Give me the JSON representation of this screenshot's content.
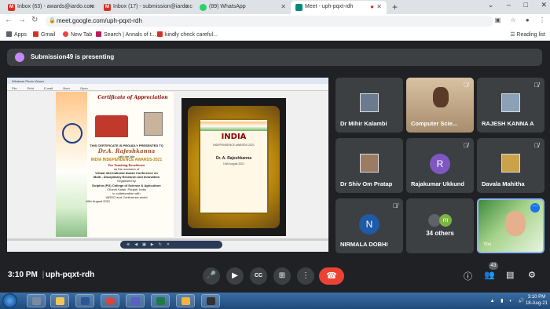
{
  "browser": {
    "tabs": [
      {
        "label": "Inbox (63) - awards@iardo.com",
        "favicon_color": "#d93025",
        "active": false
      },
      {
        "label": "Inbox (17) - submission@iardo.c",
        "favicon_color": "#d93025",
        "active": false
      },
      {
        "label": "(89) WhatsApp",
        "favicon_color": "#25d366",
        "active": false
      },
      {
        "label": "Meet - uph-pqxt-rdh",
        "favicon_color": "#00897b",
        "active": true
      }
    ],
    "url": "meet.google.com/uph-pqxt-rdh",
    "bookmarks": [
      {
        "label": "Apps",
        "color": "#5f6368"
      },
      {
        "label": "Gmail",
        "color": "#d93025"
      },
      {
        "label": "New Tab",
        "color": "#e8453c"
      },
      {
        "label": "Search | Annals of t...",
        "color": "#c2185b"
      },
      {
        "label": "kindly check careful...",
        "color": "#d93025"
      }
    ],
    "reading_list": "Reading list"
  },
  "meet": {
    "presenting_banner": "Submission49 is presenting",
    "shared_screen": {
      "window_title": "Windows Photo Viewer",
      "menu": [
        "File",
        "Print",
        "E-mail",
        "Burn",
        "Open"
      ],
      "certificate": {
        "title": "Certificate of Appreciation",
        "lines": [
          "THIS CERTIFICATE IS PROUDLY PRESENTED TO",
          "Dr.A. Rajeshkanna",
          "with the title",
          "INDIA INDEPENDENCE AWARDS-2021",
          "For Teaching Excellence",
          "on the occasion of",
          "Virtual International Award Conference on",
          "Multi - Disciplinary Research and Innovation",
          "Organised by",
          "Dolphin (PG) College of Science & Agriculture",
          "Chunni Kalan, Punjab, India",
          "in collaboration with",
          "IARDO and Conference world",
          "16th August 2021"
        ]
      },
      "framed": {
        "heading": "INDIA",
        "subheading": "INDEPENDENCE AWARDS-2021",
        "name": "Dr. A. Rajeshkanna",
        "date": "16th August 2021"
      }
    },
    "participants": [
      {
        "name": "Dr Mihir Kalambi",
        "type": "photo",
        "muted": false
      },
      {
        "name": "Computer Scie...",
        "type": "camera",
        "muted": true
      },
      {
        "name": "RAJESH KANNA A",
        "type": "photo",
        "muted": true
      },
      {
        "name": "Dr Shiv Om Pratap",
        "type": "photo",
        "muted": false
      },
      {
        "name": "Rajakumar Ukkund",
        "type": "initial",
        "initial": "R",
        "color": "#7e57c2",
        "muted": true
      },
      {
        "name": "Davala Mahitha",
        "type": "photo",
        "muted": true
      },
      {
        "name": "NIRMALA DOBHI",
        "type": "initial",
        "initial": "N",
        "color": "#1e5aa8",
        "muted": true
      },
      {
        "name": "34 others",
        "type": "others",
        "initial": "m"
      },
      {
        "name": "You",
        "type": "self"
      }
    ],
    "bottom": {
      "time": "3:10 PM",
      "code": "uph-pqxt-rdh",
      "participant_count": "43"
    }
  },
  "taskbar": {
    "clock_time": "3:10 PM",
    "clock_date": "18-Aug-21",
    "apps": [
      "#7a8aa0",
      "#4a7fc1",
      "#e34234",
      "#5b5fc7",
      "#1d7a45",
      "#f3b33d",
      "#333"
    ]
  }
}
